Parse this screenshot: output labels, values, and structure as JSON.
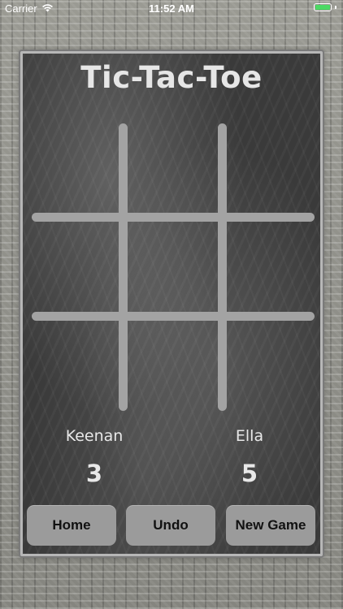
{
  "status_bar": {
    "carrier": "Carrier",
    "time": "11:52 AM",
    "battery_color": "#4cd964",
    "icons": [
      "wifi-icon",
      "battery-icon"
    ]
  },
  "game": {
    "title": "Tic-Tac-Toe",
    "board_cells": [
      "",
      "",
      "",
      "",
      "",
      "",
      "",
      "",
      ""
    ]
  },
  "players": [
    {
      "name": "Keenan",
      "score": "3"
    },
    {
      "name": "Ella",
      "score": "5"
    }
  ],
  "buttons": {
    "home": "Home",
    "undo": "Undo",
    "new_game": "New Game"
  },
  "colors": {
    "chalkboard": "#3a3a3a",
    "chalk_text": "#e6e6e6",
    "grid_lines": "#a3a3a3",
    "button_bg": "#9b9b9b"
  }
}
